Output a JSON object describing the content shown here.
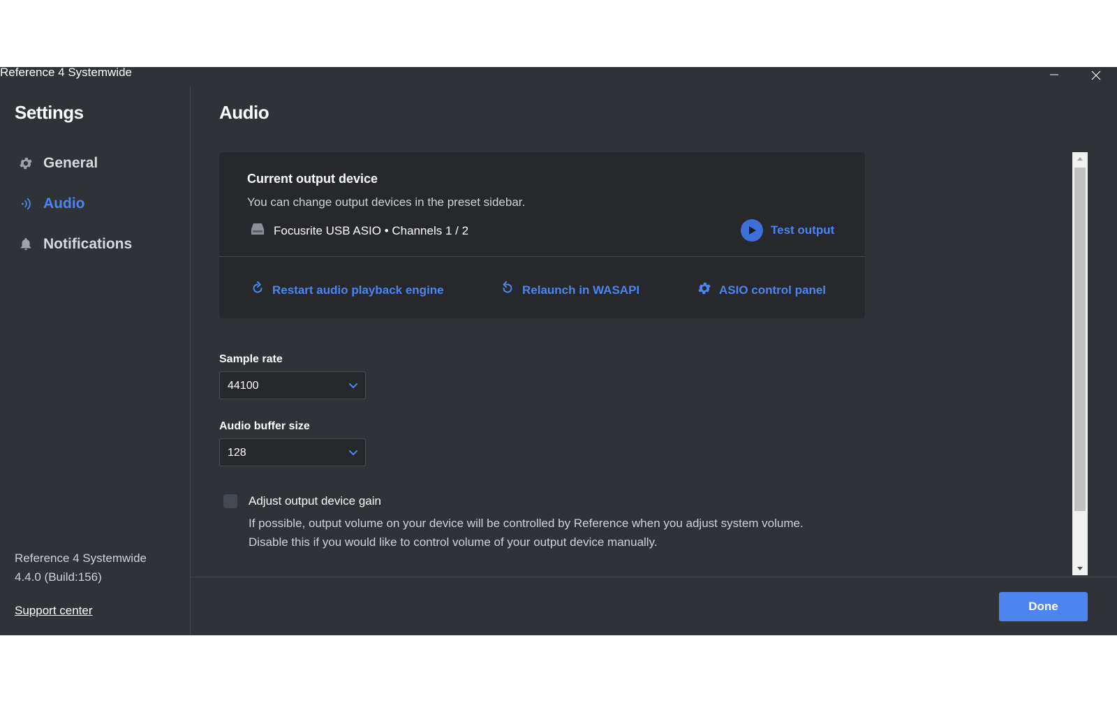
{
  "window": {
    "title": "Reference 4 Systemwide"
  },
  "sidebar": {
    "title": "Settings",
    "items": [
      {
        "label": "General",
        "icon": "gear-icon"
      },
      {
        "label": "Audio",
        "icon": "audio-waves-icon",
        "active": true
      },
      {
        "label": "Notifications",
        "icon": "bell-icon"
      }
    ],
    "app_name": "Reference 4 Systemwide",
    "app_version": "4.4.0 (Build:156)",
    "support_link": "Support center"
  },
  "main": {
    "title": "Audio",
    "device_card": {
      "heading": "Current output device",
      "subtitle": "You can change output devices in the preset sidebar.",
      "device_name": "Focusrite USB ASIO • Channels 1 / 2",
      "test_output": "Test output",
      "actions": [
        {
          "label": "Restart audio playback engine",
          "icon": "restart-icon"
        },
        {
          "label": "Relaunch in WASAPI",
          "icon": "relaunch-icon"
        },
        {
          "label": "ASIO control panel",
          "icon": "gear-icon"
        }
      ]
    },
    "sample_rate": {
      "label": "Sample rate",
      "value": "44100"
    },
    "buffer_size": {
      "label": "Audio buffer size",
      "value": "128"
    },
    "gain": {
      "label": "Adjust output device gain",
      "checked": false,
      "desc_line1": "If possible, output volume on your device will be controlled by Reference when you adjust system volume.",
      "desc_line2": "Disable this if you would like to control volume of your output device manually."
    },
    "done_label": "Done"
  },
  "colors": {
    "background": "#2f3237",
    "card": "#26282b",
    "accent": "#4e84ef"
  }
}
